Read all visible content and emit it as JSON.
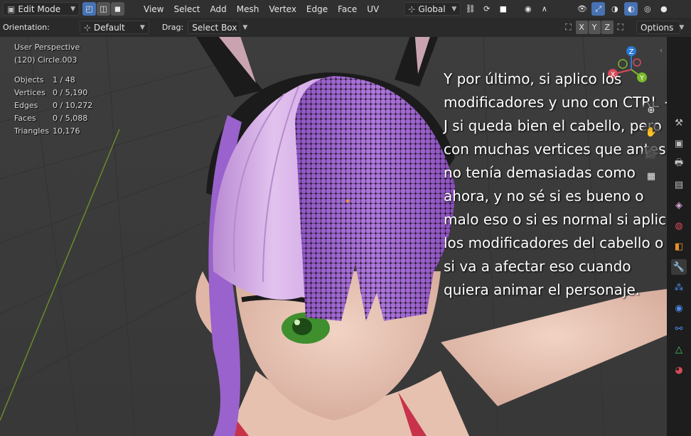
{
  "header": {
    "mode": "Edit Mode",
    "menus": [
      "View",
      "Select",
      "Add",
      "Mesh",
      "Vertex",
      "Edge",
      "Face",
      "UV"
    ],
    "transform_orientation": "Global"
  },
  "toolbar": {
    "orientation_label": "Orientation:",
    "orientation_value": "Default",
    "drag_label": "Drag:",
    "drag_value": "Select Box",
    "axis_x": "X",
    "axis_y": "Y",
    "axis_z": "Z",
    "options_label": "Options"
  },
  "viewport": {
    "view_name": "User Perspective",
    "object_name": "(120) Circle.003",
    "stats": [
      {
        "label": "Objects",
        "value": "1 / 48"
      },
      {
        "label": "Vertices",
        "value": "0 / 5,190"
      },
      {
        "label": "Edges",
        "value": "0 / 10,272"
      },
      {
        "label": "Faces",
        "value": "0 / 5,088"
      },
      {
        "label": "Triangles",
        "value": "10,176"
      }
    ],
    "gizmo": {
      "x": "X",
      "y": "Y",
      "z": "Z"
    }
  },
  "question_text": "Y por último, si aplico los modificadores y uno con CTRL + J si queda bien el cabello, pero con muchas vertices que antes no tenía demasiadas como ahora, y no sé si es bueno o malo eso o si es normal si aplico los modificadores del cabello o si va a afectar eso cuando quiera animar el personaje.",
  "colors": {
    "accent": "#4772b3",
    "hair_purple": "#a06ad0",
    "hair_light": "#d9b3e8",
    "skin": "#e8c4b3",
    "eye_green": "#3f8f2f"
  },
  "icons": {
    "nav_tools": [
      "zoom-icon",
      "hand-pan-icon",
      "camera-icon",
      "grid-icon"
    ],
    "properties": [
      "tool-icon",
      "render-icon",
      "output-icon",
      "view-layer-icon",
      "scene-icon",
      "world-icon",
      "object-icon",
      "modifier-icon",
      "particles-icon",
      "physics-icon",
      "constraints-icon",
      "data-icon",
      "material-icon"
    ]
  }
}
